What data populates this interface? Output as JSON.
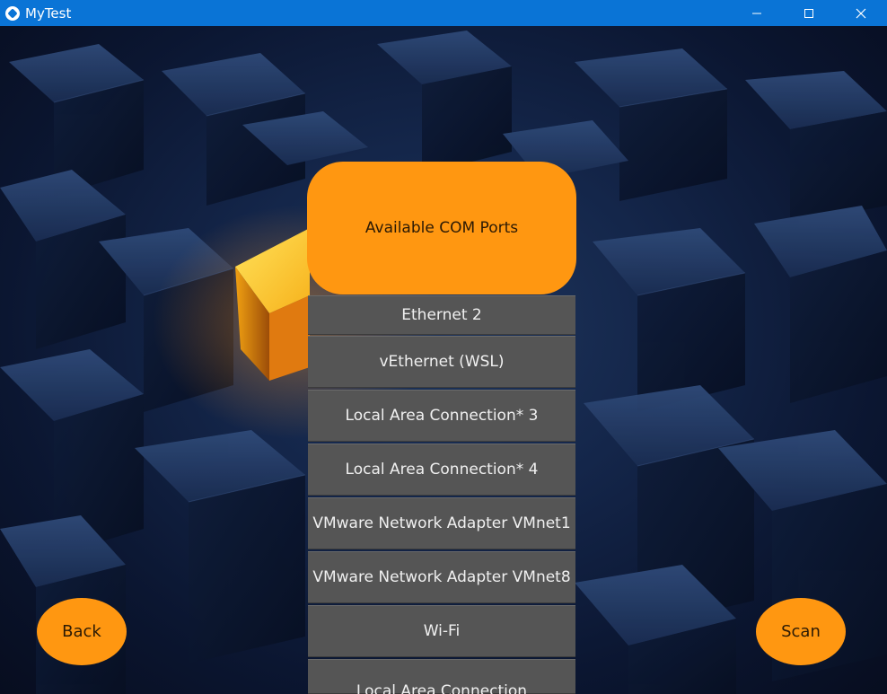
{
  "window": {
    "title": "MyTest",
    "app_icon": "kivy-logo-icon",
    "controls": [
      "minimize-icon",
      "maximize-icon",
      "close-icon"
    ]
  },
  "header": {
    "label": "Available COM Ports"
  },
  "ports": [
    "Ethernet 2",
    "vEthernet (WSL)",
    "Local Area Connection* 3",
    "Local Area Connection* 4",
    "VMware Network Adapter VMnet1",
    "VMware Network Adapter VMnet8",
    "Wi-Fi",
    "Local Area Connection"
  ],
  "buttons": {
    "back": "Back",
    "scan": "Scan"
  },
  "colors": {
    "titlebar": "#0a74d6",
    "accent_orange": "#ff9711",
    "list_item": "#555555",
    "background": "#14264a"
  }
}
